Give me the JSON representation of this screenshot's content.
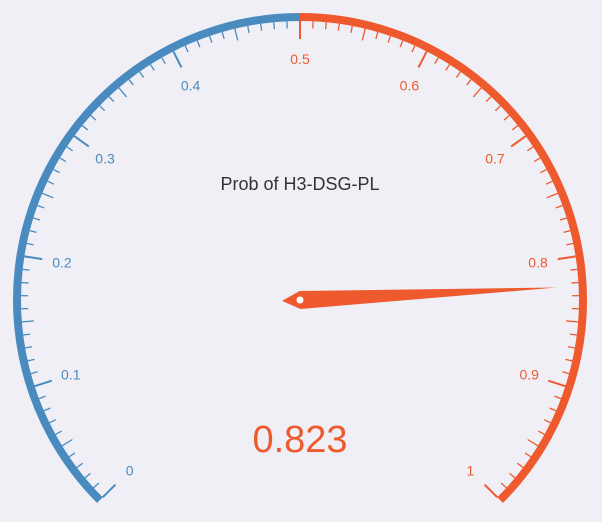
{
  "chart_data": {
    "type": "gauge",
    "title": "Prob of H3-DSG-PL",
    "value": 0.823,
    "value_label": "0.823",
    "min": 0,
    "max": 1,
    "major_ticks": [
      0,
      0.1,
      0.2,
      0.3,
      0.4,
      0.5,
      0.6,
      0.7,
      0.8,
      0.9,
      1
    ],
    "tick_labels": [
      "0",
      "0.1",
      "0.2",
      "0.3",
      "0.4",
      "0.5",
      "0.6",
      "0.7",
      "0.8",
      "0.9",
      "1"
    ],
    "minor_ticks_per_major": 10,
    "threshold": 0.5,
    "colors": {
      "low": "#4a8bbf",
      "high": "#ee5a2d",
      "background": "#f0eff6",
      "title_text": "#333333"
    }
  }
}
